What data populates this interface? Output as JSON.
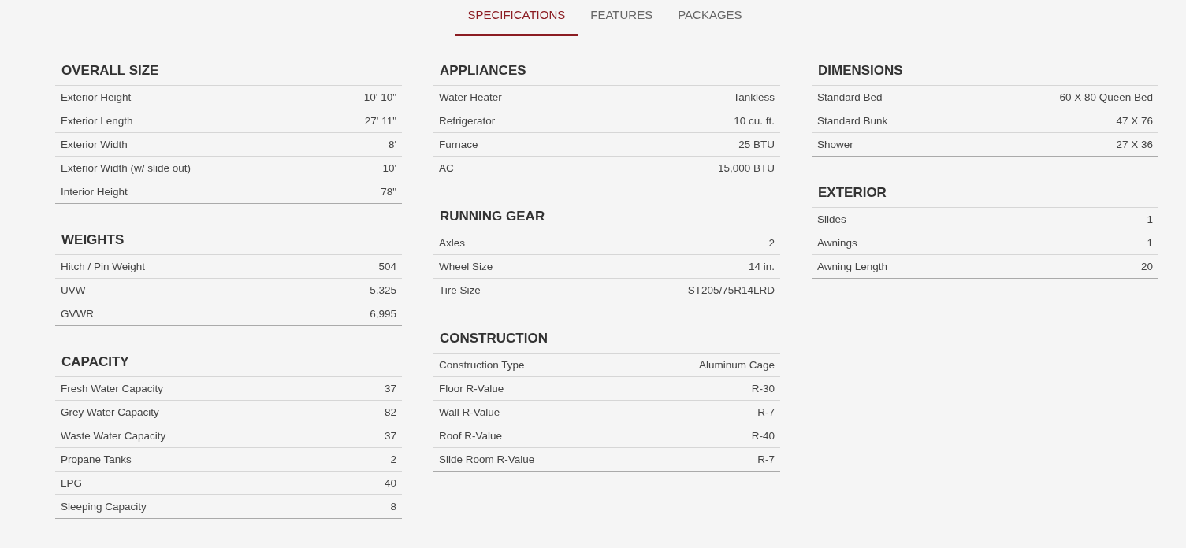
{
  "tabs": [
    {
      "label": "SPECIFICATIONS",
      "selected": true
    },
    {
      "label": "FEATURES",
      "selected": false
    },
    {
      "label": "PACKAGES",
      "selected": false
    }
  ],
  "columns": [
    [
      {
        "title": "OVERALL SIZE",
        "rows": [
          {
            "label": "Exterior Height",
            "value": "10' 10\""
          },
          {
            "label": "Exterior Length",
            "value": "27' 11\""
          },
          {
            "label": "Exterior Width",
            "value": "8'"
          },
          {
            "label": "Exterior Width (w/ slide out)",
            "value": "10'"
          },
          {
            "label": "Interior Height",
            "value": "78\""
          }
        ]
      },
      {
        "title": "WEIGHTS",
        "rows": [
          {
            "label": "Hitch / Pin Weight",
            "value": "504"
          },
          {
            "label": "UVW",
            "value": "5,325"
          },
          {
            "label": "GVWR",
            "value": "6,995"
          }
        ]
      },
      {
        "title": "CAPACITY",
        "rows": [
          {
            "label": "Fresh Water Capacity",
            "value": "37"
          },
          {
            "label": "Grey Water Capacity",
            "value": "82"
          },
          {
            "label": "Waste Water Capacity",
            "value": "37"
          },
          {
            "label": "Propane Tanks",
            "value": "2"
          },
          {
            "label": "LPG",
            "value": "40"
          },
          {
            "label": "Sleeping Capacity",
            "value": "8"
          }
        ]
      }
    ],
    [
      {
        "title": "APPLIANCES",
        "rows": [
          {
            "label": "Water Heater",
            "value": "Tankless"
          },
          {
            "label": "Refrigerator",
            "value": "10 cu. ft."
          },
          {
            "label": "Furnace",
            "value": "25 BTU"
          },
          {
            "label": "AC",
            "value": "15,000 BTU"
          }
        ]
      },
      {
        "title": "RUNNING GEAR",
        "rows": [
          {
            "label": "Axles",
            "value": "2"
          },
          {
            "label": "Wheel Size",
            "value": "14 in."
          },
          {
            "label": "Tire Size",
            "value": "ST205/75R14LRD"
          }
        ]
      },
      {
        "title": "CONSTRUCTION",
        "rows": [
          {
            "label": "Construction Type",
            "value": "Aluminum Cage"
          },
          {
            "label": "Floor R-Value",
            "value": "R-30"
          },
          {
            "label": "Wall R-Value",
            "value": "R-7"
          },
          {
            "label": "Roof R-Value",
            "value": "R-40"
          },
          {
            "label": "Slide Room R-Value",
            "value": "R-7"
          }
        ]
      }
    ],
    [
      {
        "title": "DIMENSIONS",
        "rows": [
          {
            "label": "Standard Bed",
            "value": "60 X 80 Queen Bed"
          },
          {
            "label": "Standard Bunk",
            "value": "47 X 76"
          },
          {
            "label": "Shower",
            "value": "27 X 36"
          }
        ]
      },
      {
        "title": "EXTERIOR",
        "rows": [
          {
            "label": "Slides",
            "value": "1"
          },
          {
            "label": "Awnings",
            "value": "1"
          },
          {
            "label": "Awning Length",
            "value": "20"
          }
        ]
      }
    ]
  ]
}
